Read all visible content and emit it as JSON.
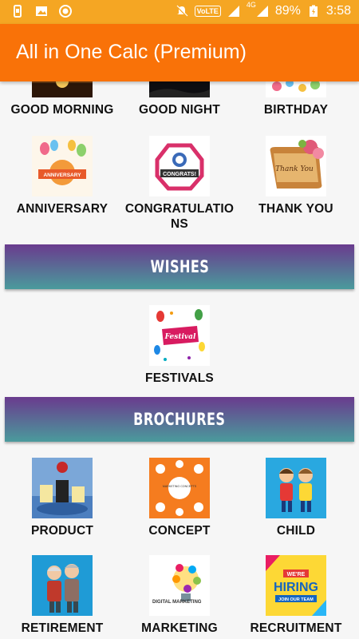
{
  "status_bar": {
    "battery": "89%",
    "time": "3:58",
    "network": "4G",
    "volte": "VoLTE"
  },
  "app_bar": {
    "title": "All in One Calc (Premium)"
  },
  "greetings": [
    {
      "label": "GOOD MORNING"
    },
    {
      "label": "GOOD NIGHT"
    },
    {
      "label": "BIRTHDAY"
    },
    {
      "label": "ANNIVERSARY"
    },
    {
      "label": "CONGRATULATIONS"
    },
    {
      "label": "THANK YOU"
    }
  ],
  "wishes": {
    "header": "WISHES",
    "items": [
      {
        "label": "FESTIVALS"
      }
    ]
  },
  "brochures": {
    "header": "BROCHURES",
    "items": [
      {
        "label": "PRODUCT"
      },
      {
        "label": "CONCEPT"
      },
      {
        "label": "CHILD"
      },
      {
        "label": "RETIREMENT"
      },
      {
        "label": "MARKETING"
      },
      {
        "label": "RECRUITMENT"
      }
    ]
  },
  "images": {
    "anniversary_text": "ANNIVERSARY",
    "congrats_text": "CONGRATS!",
    "thankyou_text": "Thank You",
    "festival_text": "Festival",
    "concept_text": "MARKETING CONCEPTS",
    "marketing_text": "DIGITAL MARKETING",
    "hiring_top": "WE'RE",
    "hiring_main": "HIRING",
    "hiring_bottom": "JOIN OUR TEAM"
  }
}
